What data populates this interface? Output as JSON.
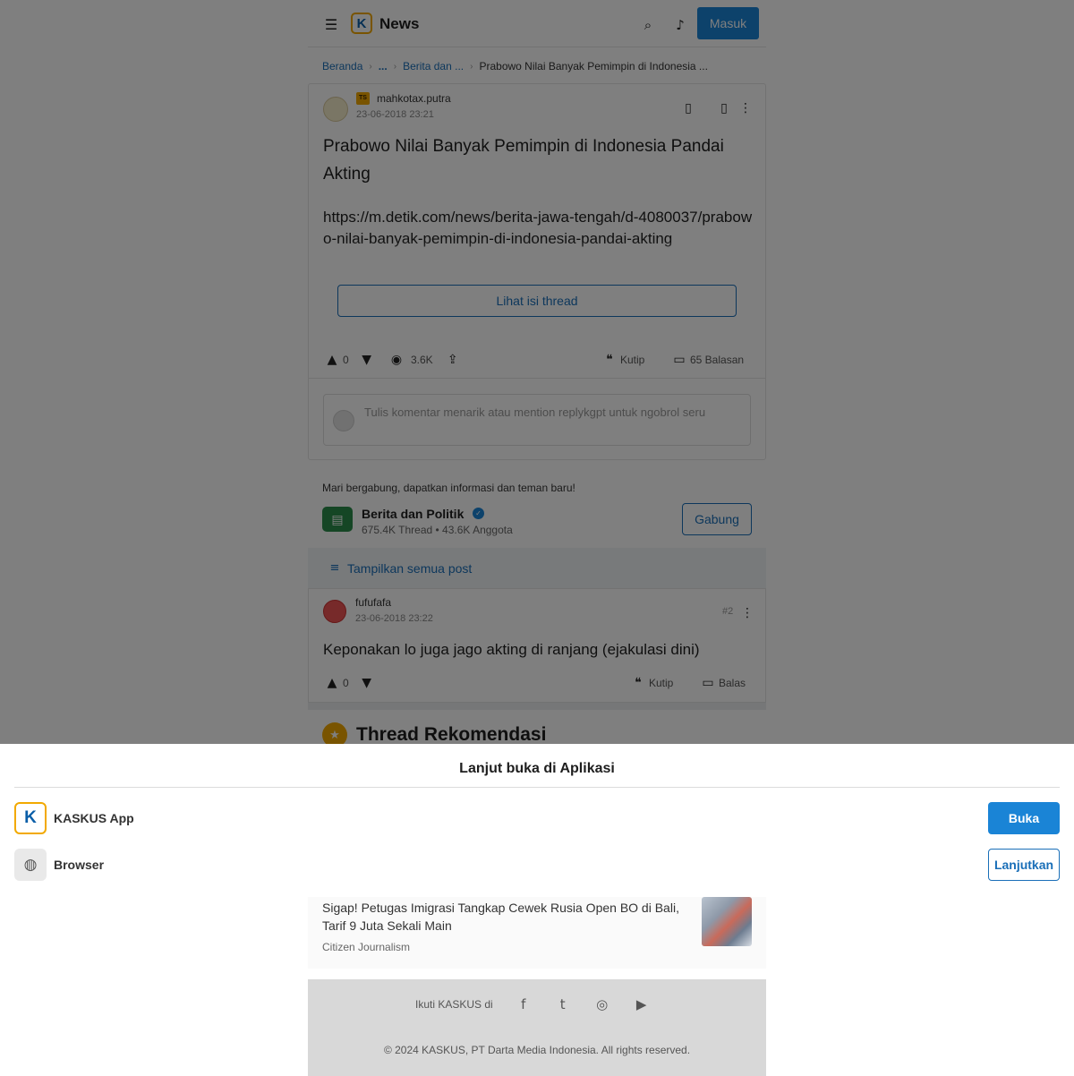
{
  "header": {
    "app_title": "News",
    "login_label": "Masuk",
    "icons": [
      "hamburger-icon",
      "kaskus-logo-icon",
      "search-icon",
      "notification-icon"
    ]
  },
  "breadcrumb": {
    "home": "Beranda",
    "ellipsis": "...",
    "category": "Berita dan ...",
    "current": "Prabowo Nilai Banyak Pemimpin di Indonesia ..."
  },
  "thread": {
    "badge": "TS",
    "username": "mahkotax.putra",
    "date": "23-06-2018 23:21",
    "title": "Prabowo Nilai Banyak Pemimpin di Indonesia Pandai Akting",
    "body": "https://m.detik.com/news/berita-jawa-tengah/d-4080037/prabowo-nilai-banyak-pemimpin-di-indonesia-pandai-akting",
    "view_label": "Lihat isi thread",
    "votes": "0",
    "views": "3.6K",
    "quote_label": "Kutip",
    "replies_label": "65 Balasan",
    "comment_placeholder": "Tulis komentar menarik atau mention replykgpt untuk ngobrol seru"
  },
  "community": {
    "invite": "Mari bergabung, dapatkan informasi dan teman baru!",
    "name": "Berita dan Politik",
    "stats": "675.4K Thread • 43.6K Anggota",
    "join_label": "Gabung"
  },
  "show_all_label": "Tampilkan semua post",
  "reply": {
    "username": "fufufafa",
    "date": "23-06-2018 23:22",
    "number": "#2",
    "text": "Keponakan lo juga jago akting di ranjang (ejakulasi dini)",
    "votes": "0",
    "quote_label": "Kutip",
    "reply_label": "Balas"
  },
  "recommendation": {
    "heading": "Thread Rekomendasi",
    "item_title": "Sigap! Petugas Imigrasi Tangkap Cewek Rusia Open BO di Bali, Tarif 9 Juta Sekali Main",
    "item_source": "Citizen Journalism"
  },
  "footer": {
    "follow_text": "Ikuti KASKUS di",
    "copyright": "© 2024 KASKUS, PT Darta Media Indonesia. All rights reserved."
  },
  "sheet": {
    "title": "Lanjut buka di Aplikasi",
    "option_app": "KASKUS App",
    "option_browser": "Browser",
    "open_label": "Buka",
    "continue_label": "Lanjutkan"
  },
  "colors": {
    "accent_blue": "#1a84d6",
    "link_blue": "#1a6fb8",
    "kaskus_yellow": "#f2a900",
    "community_green": "#2b8c4a"
  }
}
